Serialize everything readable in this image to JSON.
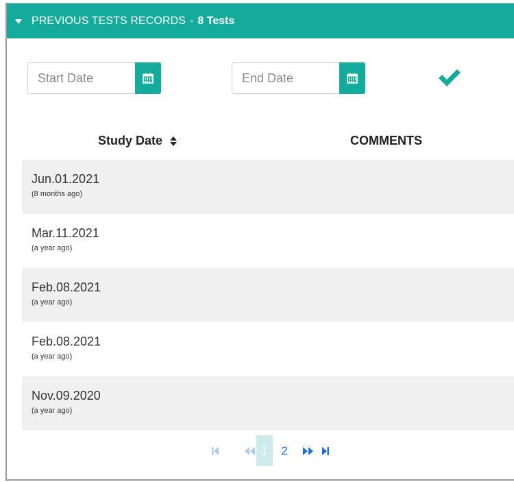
{
  "panel": {
    "title": "PREVIOUS TESTS RECORDS",
    "separator": "-",
    "count_label": "8 Tests"
  },
  "filters": {
    "start_placeholder": "Start Date",
    "end_placeholder": "End Date",
    "start_value": "",
    "end_value": ""
  },
  "table": {
    "columns": [
      "Study Date",
      "COMMENTS"
    ],
    "rows": [
      {
        "date": "Jun.01.2021",
        "ago": "(8 months ago)",
        "comment": ""
      },
      {
        "date": "Mar.11.2021",
        "ago": "(a year ago)",
        "comment": ""
      },
      {
        "date": "Feb.08.2021",
        "ago": "(a year ago)",
        "comment": ""
      },
      {
        "date": "Feb.08.2021",
        "ago": "(a year ago)",
        "comment": ""
      },
      {
        "date": "Nov.09.2020",
        "ago": "(a year ago)",
        "comment": ""
      }
    ]
  },
  "pagination": {
    "pages": [
      "1",
      "2"
    ],
    "current_page": "1"
  },
  "colors": {
    "accent": "#14aa9c",
    "row_alt": "#f0f0f0",
    "link": "#1d6fd1",
    "disabled": "#a9cdea"
  },
  "icons": {
    "header": "caret-down-icon",
    "calendar": "calendar-icon",
    "apply": "checkmark-icon",
    "sort": "sort-icon",
    "first": "first-page-icon",
    "prev": "previous-page-icon",
    "next": "next-page-icon",
    "last": "last-page-icon"
  }
}
